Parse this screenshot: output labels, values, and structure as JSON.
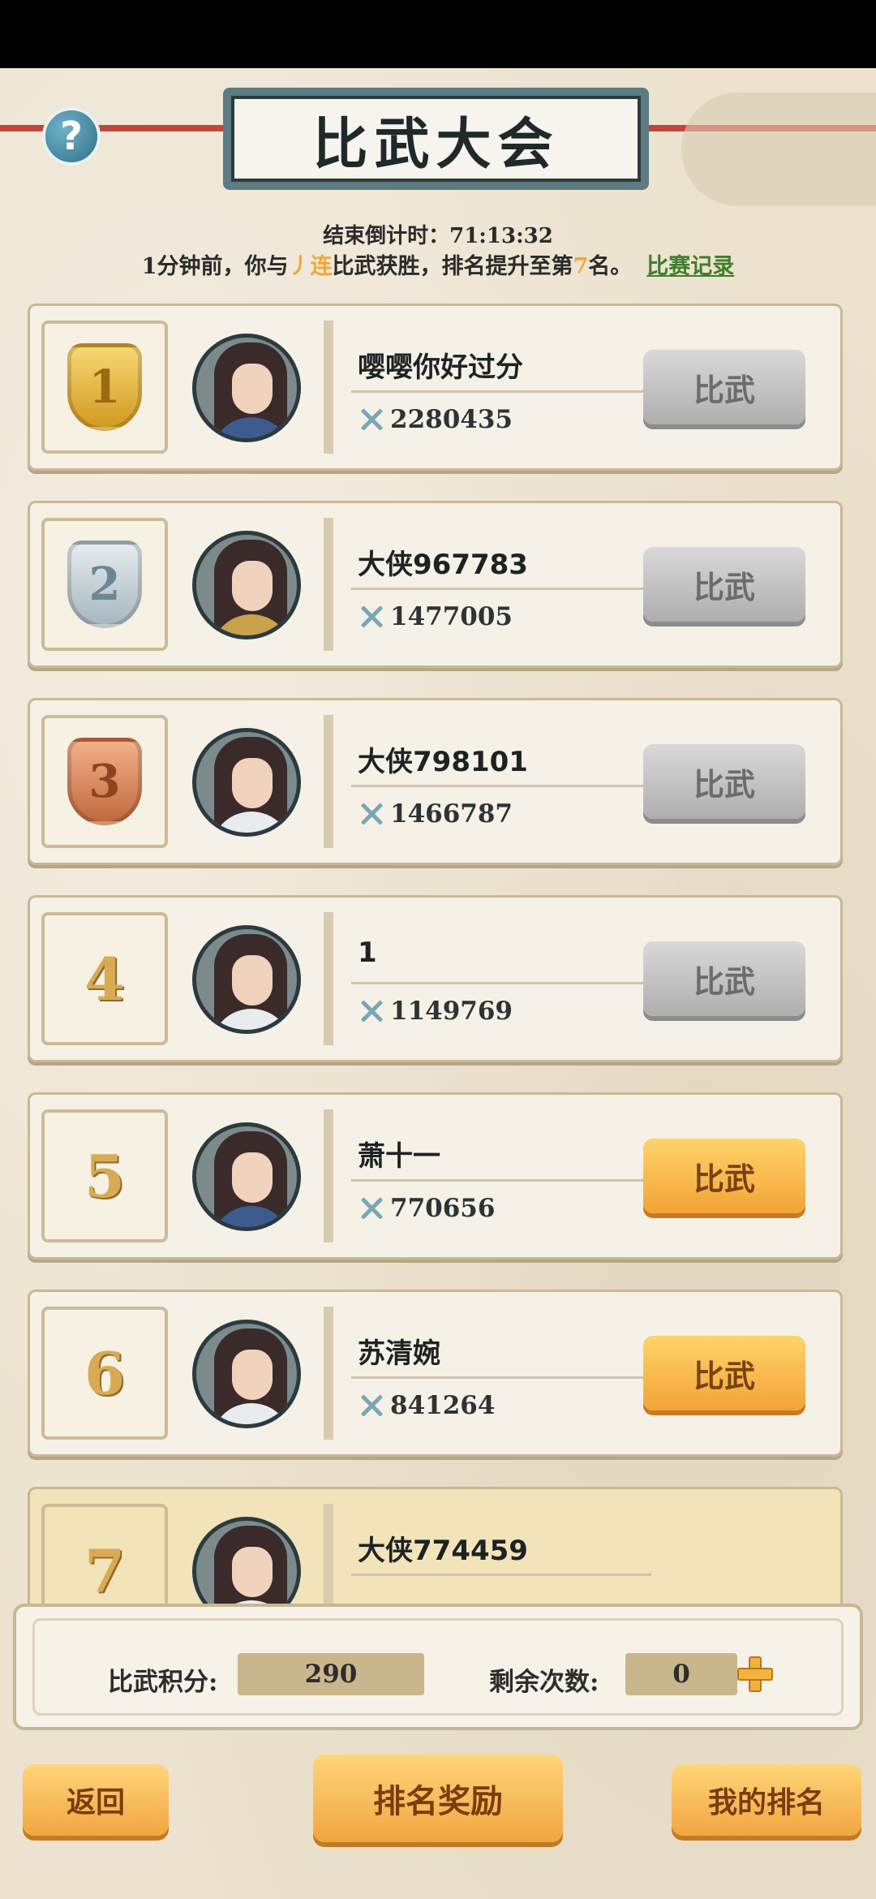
{
  "header": {
    "title": "比武大会",
    "help_symbol": "?",
    "countdown_label": "结束倒计时：",
    "countdown_value": "71:13:32",
    "notice_before": "1分钟前，你与",
    "notice_highlight": "丿连",
    "notice_middle": "比武获胜，排名提升至第",
    "notice_rank": "7",
    "notice_after": "名。",
    "record_link": "比赛记录"
  },
  "rankings": [
    {
      "rank": "1",
      "medal": "gold",
      "name": "嘤嘤你好过分",
      "power": "2280435",
      "button": "比武",
      "button_state": "grey"
    },
    {
      "rank": "2",
      "medal": "silver",
      "name": "大侠967783",
      "power": "1477005",
      "button": "比武",
      "button_state": "grey"
    },
    {
      "rank": "3",
      "medal": "bronze",
      "name": "大侠798101",
      "power": "1466787",
      "button": "比武",
      "button_state": "grey"
    },
    {
      "rank": "4",
      "medal": "none",
      "name": "1",
      "power": "1149769",
      "button": "比武",
      "button_state": "grey"
    },
    {
      "rank": "5",
      "medal": "none",
      "name": "萧十一",
      "power": "770656",
      "button": "比武",
      "button_state": "orange"
    },
    {
      "rank": "6",
      "medal": "none",
      "name": "苏清婉",
      "power": "841264",
      "button": "比武",
      "button_state": "orange"
    },
    {
      "rank": "7",
      "medal": "none",
      "name": "大侠774459"
    }
  ],
  "score_panel": {
    "points_label": "比武积分:",
    "points_value": "290",
    "remaining_label": "剩余次数:",
    "remaining_value": "0"
  },
  "bottom_buttons": {
    "back": "返回",
    "reward": "排名奖励",
    "my_rank": "我的排名"
  },
  "colors": {
    "accent_orange": "#f3a436",
    "link_green": "#3f7f2a",
    "highlight": "#f0a83a"
  }
}
